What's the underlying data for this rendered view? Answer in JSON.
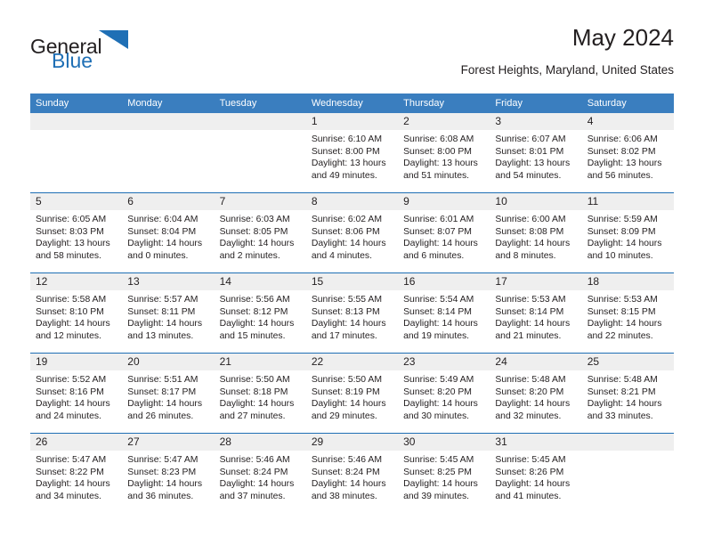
{
  "brand": {
    "name_part1": "General",
    "name_part2": "Blue",
    "logo_icon": "triangle-icon",
    "color_primary": "#1f6fb5"
  },
  "header": {
    "title": "May 2024",
    "subtitle": "Forest Heights, Maryland, United States"
  },
  "calendar": {
    "header_bg": "#3a7ebf",
    "row_divider_color": "#1f6fb5",
    "day_band_bg": "#efefef",
    "weekdays": [
      "Sunday",
      "Monday",
      "Tuesday",
      "Wednesday",
      "Thursday",
      "Friday",
      "Saturday"
    ],
    "weeks": [
      [
        {
          "day": "",
          "lines": []
        },
        {
          "day": "",
          "lines": []
        },
        {
          "day": "",
          "lines": []
        },
        {
          "day": "1",
          "lines": [
            "Sunrise: 6:10 AM",
            "Sunset: 8:00 PM",
            "Daylight: 13 hours",
            "and 49 minutes."
          ]
        },
        {
          "day": "2",
          "lines": [
            "Sunrise: 6:08 AM",
            "Sunset: 8:00 PM",
            "Daylight: 13 hours",
            "and 51 minutes."
          ]
        },
        {
          "day": "3",
          "lines": [
            "Sunrise: 6:07 AM",
            "Sunset: 8:01 PM",
            "Daylight: 13 hours",
            "and 54 minutes."
          ]
        },
        {
          "day": "4",
          "lines": [
            "Sunrise: 6:06 AM",
            "Sunset: 8:02 PM",
            "Daylight: 13 hours",
            "and 56 minutes."
          ]
        }
      ],
      [
        {
          "day": "5",
          "lines": [
            "Sunrise: 6:05 AM",
            "Sunset: 8:03 PM",
            "Daylight: 13 hours",
            "and 58 minutes."
          ]
        },
        {
          "day": "6",
          "lines": [
            "Sunrise: 6:04 AM",
            "Sunset: 8:04 PM",
            "Daylight: 14 hours",
            "and 0 minutes."
          ]
        },
        {
          "day": "7",
          "lines": [
            "Sunrise: 6:03 AM",
            "Sunset: 8:05 PM",
            "Daylight: 14 hours",
            "and 2 minutes."
          ]
        },
        {
          "day": "8",
          "lines": [
            "Sunrise: 6:02 AM",
            "Sunset: 8:06 PM",
            "Daylight: 14 hours",
            "and 4 minutes."
          ]
        },
        {
          "day": "9",
          "lines": [
            "Sunrise: 6:01 AM",
            "Sunset: 8:07 PM",
            "Daylight: 14 hours",
            "and 6 minutes."
          ]
        },
        {
          "day": "10",
          "lines": [
            "Sunrise: 6:00 AM",
            "Sunset: 8:08 PM",
            "Daylight: 14 hours",
            "and 8 minutes."
          ]
        },
        {
          "day": "11",
          "lines": [
            "Sunrise: 5:59 AM",
            "Sunset: 8:09 PM",
            "Daylight: 14 hours",
            "and 10 minutes."
          ]
        }
      ],
      [
        {
          "day": "12",
          "lines": [
            "Sunrise: 5:58 AM",
            "Sunset: 8:10 PM",
            "Daylight: 14 hours",
            "and 12 minutes."
          ]
        },
        {
          "day": "13",
          "lines": [
            "Sunrise: 5:57 AM",
            "Sunset: 8:11 PM",
            "Daylight: 14 hours",
            "and 13 minutes."
          ]
        },
        {
          "day": "14",
          "lines": [
            "Sunrise: 5:56 AM",
            "Sunset: 8:12 PM",
            "Daylight: 14 hours",
            "and 15 minutes."
          ]
        },
        {
          "day": "15",
          "lines": [
            "Sunrise: 5:55 AM",
            "Sunset: 8:13 PM",
            "Daylight: 14 hours",
            "and 17 minutes."
          ]
        },
        {
          "day": "16",
          "lines": [
            "Sunrise: 5:54 AM",
            "Sunset: 8:14 PM",
            "Daylight: 14 hours",
            "and 19 minutes."
          ]
        },
        {
          "day": "17",
          "lines": [
            "Sunrise: 5:53 AM",
            "Sunset: 8:14 PM",
            "Daylight: 14 hours",
            "and 21 minutes."
          ]
        },
        {
          "day": "18",
          "lines": [
            "Sunrise: 5:53 AM",
            "Sunset: 8:15 PM",
            "Daylight: 14 hours",
            "and 22 minutes."
          ]
        }
      ],
      [
        {
          "day": "19",
          "lines": [
            "Sunrise: 5:52 AM",
            "Sunset: 8:16 PM",
            "Daylight: 14 hours",
            "and 24 minutes."
          ]
        },
        {
          "day": "20",
          "lines": [
            "Sunrise: 5:51 AM",
            "Sunset: 8:17 PM",
            "Daylight: 14 hours",
            "and 26 minutes."
          ]
        },
        {
          "day": "21",
          "lines": [
            "Sunrise: 5:50 AM",
            "Sunset: 8:18 PM",
            "Daylight: 14 hours",
            "and 27 minutes."
          ]
        },
        {
          "day": "22",
          "lines": [
            "Sunrise: 5:50 AM",
            "Sunset: 8:19 PM",
            "Daylight: 14 hours",
            "and 29 minutes."
          ]
        },
        {
          "day": "23",
          "lines": [
            "Sunrise: 5:49 AM",
            "Sunset: 8:20 PM",
            "Daylight: 14 hours",
            "and 30 minutes."
          ]
        },
        {
          "day": "24",
          "lines": [
            "Sunrise: 5:48 AM",
            "Sunset: 8:20 PM",
            "Daylight: 14 hours",
            "and 32 minutes."
          ]
        },
        {
          "day": "25",
          "lines": [
            "Sunrise: 5:48 AM",
            "Sunset: 8:21 PM",
            "Daylight: 14 hours",
            "and 33 minutes."
          ]
        }
      ],
      [
        {
          "day": "26",
          "lines": [
            "Sunrise: 5:47 AM",
            "Sunset: 8:22 PM",
            "Daylight: 14 hours",
            "and 34 minutes."
          ]
        },
        {
          "day": "27",
          "lines": [
            "Sunrise: 5:47 AM",
            "Sunset: 8:23 PM",
            "Daylight: 14 hours",
            "and 36 minutes."
          ]
        },
        {
          "day": "28",
          "lines": [
            "Sunrise: 5:46 AM",
            "Sunset: 8:24 PM",
            "Daylight: 14 hours",
            "and 37 minutes."
          ]
        },
        {
          "day": "29",
          "lines": [
            "Sunrise: 5:46 AM",
            "Sunset: 8:24 PM",
            "Daylight: 14 hours",
            "and 38 minutes."
          ]
        },
        {
          "day": "30",
          "lines": [
            "Sunrise: 5:45 AM",
            "Sunset: 8:25 PM",
            "Daylight: 14 hours",
            "and 39 minutes."
          ]
        },
        {
          "day": "31",
          "lines": [
            "Sunrise: 5:45 AM",
            "Sunset: 8:26 PM",
            "Daylight: 14 hours",
            "and 41 minutes."
          ]
        },
        {
          "day": "",
          "lines": []
        }
      ]
    ]
  }
}
